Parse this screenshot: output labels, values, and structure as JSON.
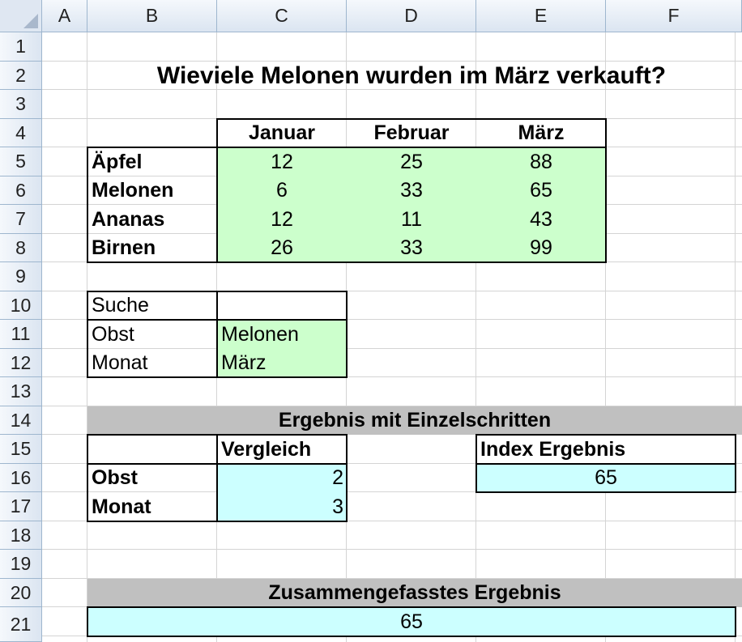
{
  "columns": [
    "A",
    "B",
    "C",
    "D",
    "E",
    "F"
  ],
  "rows": [
    "1",
    "2",
    "3",
    "4",
    "5",
    "6",
    "7",
    "8",
    "9",
    "10",
    "11",
    "12",
    "13",
    "14",
    "15",
    "16",
    "17",
    "18",
    "19",
    "20",
    "21"
  ],
  "title": "Wieviele Melonen wurden im März verkauft?",
  "table": {
    "months": [
      "Januar",
      "Februar",
      "März"
    ],
    "rows": [
      {
        "fruit": "Äpfel",
        "values": [
          "12",
          "25",
          "88"
        ]
      },
      {
        "fruit": "Melonen",
        "values": [
          "6",
          "33",
          "65"
        ]
      },
      {
        "fruit": "Ananas",
        "values": [
          "12",
          "11",
          "43"
        ]
      },
      {
        "fruit": "Birnen",
        "values": [
          "26",
          "33",
          "99"
        ]
      }
    ]
  },
  "search": {
    "label": "Suche",
    "obst_label": "Obst",
    "obst_value": "Melonen",
    "monat_label": "Monat",
    "monat_value": "März"
  },
  "steps": {
    "header": "Ergebnis mit Einzelschritten",
    "vergleich_label": "Vergleich",
    "obst_label": "Obst",
    "obst_value": "2",
    "monat_label": "Monat",
    "monat_value": "3",
    "index_label": "Index Ergebnis",
    "index_value": "65"
  },
  "combined": {
    "header": "Zusammengefasstes Ergebnis",
    "value": "65"
  },
  "colors": {
    "input_fill": "#ccffcc",
    "result_fill": "#ccffff",
    "header_fill": "#c0c0c0"
  }
}
